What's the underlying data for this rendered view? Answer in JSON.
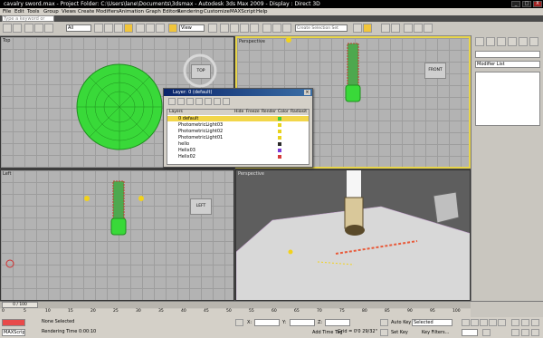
{
  "title": "cavalry sword.max    - Project Folder: C:\\Users\\lane\\Documents\\3dsmax    - Autodesk 3ds Max  2009        - Display : Direct 3D",
  "window_buttons": [
    "_",
    "□",
    "X"
  ],
  "menu": [
    "File",
    "Edit",
    "Tools",
    "Group",
    "Views",
    "Create",
    "Modifiers",
    "Animation",
    "Graph Editors",
    "Rendering",
    "Customize",
    "MAXScript",
    "Help"
  ],
  "search_placeholder": "Type a keyword or phrase",
  "toolbar": {
    "selection_filter": "All",
    "ref_coord": "View",
    "named_sel": "Create Selection Set"
  },
  "viewports": {
    "top": "Top",
    "front": "Perspective",
    "left": "Left",
    "persp": "Perspective"
  },
  "viewcube": {
    "top": "TOP",
    "front": "FRONT",
    "left": "LEFT"
  },
  "command_panel": {
    "modifier_list": "Modifier List"
  },
  "layer_window": {
    "title": "Layer: 0 (default)",
    "columns": [
      "Layers",
      "Hide",
      "Freeze",
      "Render",
      "Color",
      "Radiosit"
    ],
    "rows": [
      "0 default",
      "PhotometricLight03",
      "PhotometricLight02",
      "PhotometricLight01",
      "hello",
      "Helix03",
      "Helix02"
    ],
    "row_colors": [
      "#3ec93e",
      "#e8d21c",
      "#e8d21c",
      "#e8d21c",
      "#2a2a2a",
      "#7a3ad6",
      "#d63a3a"
    ]
  },
  "timeline": {
    "frame": "0 / 100",
    "ticks": [
      "0",
      "5",
      "10",
      "15",
      "20",
      "25",
      "30",
      "35",
      "40",
      "45",
      "50",
      "55",
      "60",
      "65",
      "70",
      "75",
      "80",
      "85",
      "90",
      "95",
      "100"
    ]
  },
  "status": {
    "selection": "None Selected",
    "render_time": "Rendering Time 0:00:10",
    "script": "MAXScript.",
    "grid": "Grid = 0'0 29/32\"",
    "add_time_tag": "Add Time Tag",
    "auto_key": "Auto Key",
    "set_key": "Set Key",
    "selected": "Selected",
    "key_filters": "Key Filters...",
    "coord_x": "",
    "coord_y": "",
    "coord_z": ""
  }
}
